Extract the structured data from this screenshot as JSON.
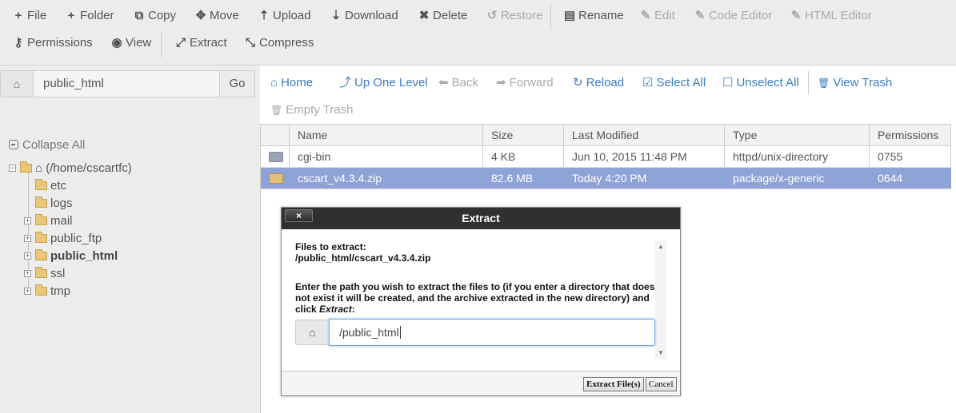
{
  "toolbar": {
    "row1": [
      {
        "icon": "plus-icon",
        "glyph": "+",
        "label": "File",
        "disabled": false
      },
      {
        "icon": "plus-icon",
        "glyph": "+",
        "label": "Folder",
        "disabled": false
      },
      {
        "icon": "copy-icon",
        "glyph": "⧉",
        "label": "Copy",
        "disabled": false
      },
      {
        "icon": "move-icon",
        "glyph": "✥",
        "label": "Move",
        "disabled": false
      },
      {
        "icon": "upload-icon",
        "glyph": "⇡",
        "label": "Upload",
        "disabled": false
      },
      {
        "icon": "download-icon",
        "glyph": "⇣",
        "label": "Download",
        "disabled": false
      },
      {
        "icon": "close-icon",
        "glyph": "✖",
        "label": "Delete",
        "disabled": false
      },
      {
        "icon": "restore-icon",
        "glyph": "↺",
        "label": "Restore",
        "disabled": true
      },
      {
        "icon": "file-icon",
        "glyph": "▤",
        "label": "Rename",
        "disabled": false
      },
      {
        "icon": "pencil-icon",
        "glyph": "✎",
        "label": "Edit",
        "disabled": true
      },
      {
        "icon": "code-editor-icon",
        "glyph": "✎",
        "label": "Code Editor",
        "disabled": true
      },
      {
        "icon": "html-editor-icon",
        "glyph": "✎",
        "label": "HTML Editor",
        "disabled": true
      }
    ],
    "row2": [
      {
        "icon": "key-icon",
        "glyph": "⚷",
        "label": "Permissions",
        "disabled": false
      },
      {
        "icon": "eye-icon",
        "glyph": "◉",
        "label": "View",
        "disabled": false
      },
      {
        "icon": "expand-icon",
        "glyph": "⤢",
        "label": "Extract",
        "disabled": false
      },
      {
        "icon": "compress-icon",
        "glyph": "⤡",
        "label": "Compress",
        "disabled": false
      }
    ]
  },
  "path_bar": {
    "value": "public_html",
    "go_label": "Go"
  },
  "tree": {
    "collapse_all": "Collapse All",
    "root": "(/home/cscartfc)",
    "items": [
      {
        "label": "etc",
        "expandable": false,
        "bold": false
      },
      {
        "label": "logs",
        "expandable": false,
        "bold": false
      },
      {
        "label": "mail",
        "expandable": true,
        "bold": false
      },
      {
        "label": "public_ftp",
        "expandable": true,
        "bold": false
      },
      {
        "label": "public_html",
        "expandable": true,
        "bold": true
      },
      {
        "label": "ssl",
        "expandable": true,
        "bold": false
      },
      {
        "label": "tmp",
        "expandable": true,
        "bold": false
      }
    ]
  },
  "nav": {
    "items": [
      {
        "icon": "home-icon",
        "glyph": "⌂",
        "label": "Home",
        "disabled": false
      },
      {
        "icon": "level-up-icon",
        "glyph": "⤴",
        "label": "Up One Level",
        "disabled": false
      },
      {
        "icon": "arrow-left-icon",
        "glyph": "⬅",
        "label": "Back",
        "disabled": true
      },
      {
        "icon": "arrow-right-icon",
        "glyph": "➡",
        "label": "Forward",
        "disabled": true
      },
      {
        "icon": "refresh-icon",
        "glyph": "↻",
        "label": "Reload",
        "disabled": false
      },
      {
        "icon": "check-square-icon",
        "glyph": "☑",
        "label": "Select All",
        "disabled": false
      },
      {
        "icon": "square-icon",
        "glyph": "☐",
        "label": "Unselect All",
        "disabled": false
      },
      {
        "icon": "trash-icon",
        "glyph": "🗑",
        "label": "View Trash",
        "disabled": false
      }
    ],
    "empty_trash": {
      "icon": "trash-icon",
      "glyph": "🗑",
      "label": "Empty Trash",
      "disabled": true
    }
  },
  "files": {
    "columns": [
      "Name",
      "Size",
      "Last Modified",
      "Type",
      "Permissions"
    ],
    "rows": [
      {
        "name": "cgi-bin",
        "size": "4 KB",
        "modified": "Jun 10, 2015 11:48 PM",
        "type": "httpd/unix-directory",
        "perms": "0755",
        "icon": "folder-icon",
        "selected": false
      },
      {
        "name": "cscart_v4.3.4.zip",
        "size": "82.6 MB",
        "modified": "Today 4:20 PM",
        "type": "package/x-generic",
        "perms": "0644",
        "icon": "archive-icon",
        "selected": true
      }
    ]
  },
  "dialog": {
    "title": "Extract",
    "close_glyph": "×",
    "files_label": "Files to extract:",
    "file_path": "/public_html/cscart_v4.3.4.zip",
    "instruction_line1": "Enter the path you wish to extract the files to (if you enter a directory that does",
    "instruction_line2": "not exist it will be created, and the archive extracted in the new directory) and",
    "instruction_click": "click ",
    "instruction_em": "Extract",
    "instruction_colon": ":",
    "path_value": "/public_html",
    "extract_button": "Extract File(s)",
    "cancel_button": "Cancel"
  },
  "colors": {
    "link": "#3b7cc4",
    "selected_row": "#8ea3d6",
    "dialog_title_bg": "#303030"
  }
}
